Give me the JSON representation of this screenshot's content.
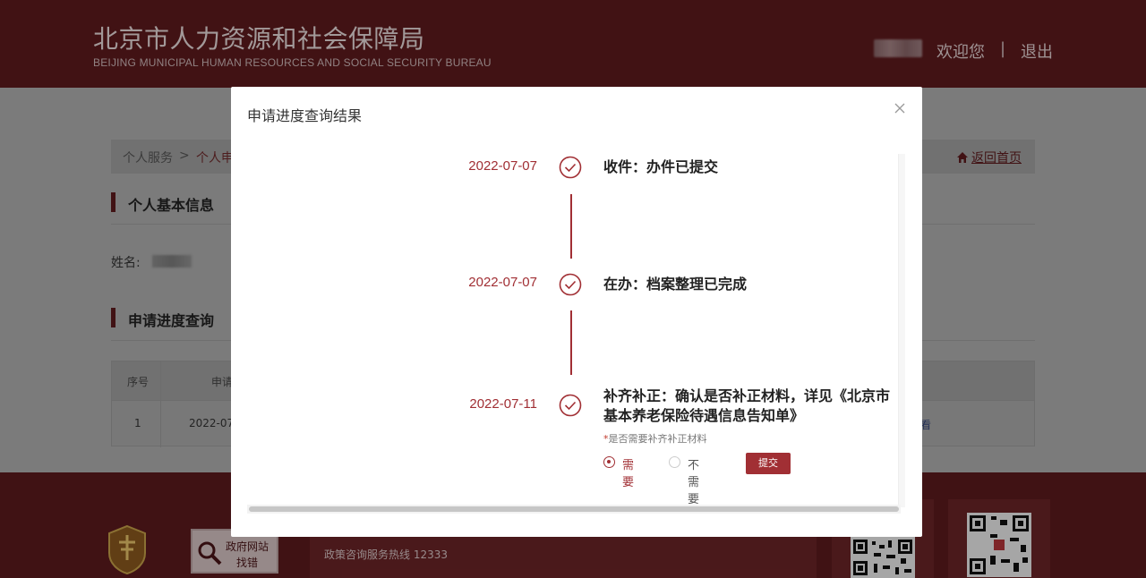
{
  "header": {
    "title": "北京市人力资源和社会保障局",
    "subtitle": "BEIJING MUNICIPAL HUMAN RESOURCES AND SOCIAL SECURITY BUREAU",
    "welcome": "欢迎您",
    "separator": "|",
    "logout": "退出"
  },
  "breadcrumb": {
    "item1": "个人服务",
    "arrow": ">",
    "item2": "个人申",
    "home_link": "返回首页"
  },
  "sections": {
    "basic_info": "个人基本信息",
    "name_label": "姓名:",
    "progress_query": "申请进度查询"
  },
  "table": {
    "headers": [
      "序号",
      "申请"
    ],
    "rows": [
      {
        "index": "1",
        "date": "2022-07",
        "action": "看"
      }
    ]
  },
  "footer": {
    "gov_site": "政府网站",
    "gov_find": "找错",
    "hotline": "政策咨询服务热线 12333"
  },
  "modal": {
    "title": "申请进度查询结果",
    "steps": [
      {
        "date": "2022-07-07",
        "text": "收件：办件已提交"
      },
      {
        "date": "2022-07-07",
        "text": "在办：档案整理已完成"
      },
      {
        "date": "2022-07-11",
        "text_line1": "补齐补正：确认是否补正材料，详见《北京市",
        "text_line2": "基本养老保险待遇信息告知单》"
      }
    ],
    "required_note": "是否需要补齐补正材料",
    "required_star": "*",
    "options": {
      "yes": "需要",
      "no": "不需要"
    },
    "submit": "提交"
  },
  "colors": {
    "accent": "#a12f34",
    "header_bg": "#5e1a1d"
  }
}
